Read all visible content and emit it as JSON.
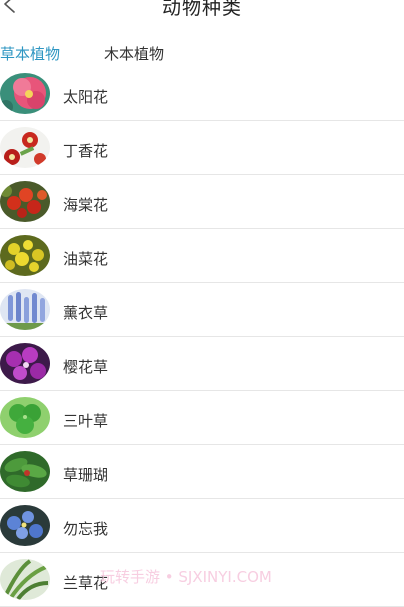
{
  "header": {
    "title": "动物种类",
    "back_icon": "chevron-left-icon"
  },
  "tabs": [
    {
      "label": "草本植物",
      "active": true
    },
    {
      "label": "木本植物",
      "active": false
    }
  ],
  "colors": {
    "accent": "#2e96c2",
    "divider": "#e6e6e6",
    "watermark": "#f7c9de"
  },
  "plants": [
    {
      "name": "太阳花",
      "icon": "pink-flower-photo"
    },
    {
      "name": "丁香花",
      "icon": "red-white-flower-photo"
    },
    {
      "name": "海棠花",
      "icon": "red-fruit-photo"
    },
    {
      "name": "油菜花",
      "icon": "yellow-flower-photo"
    },
    {
      "name": "薰衣草",
      "icon": "lavender-photo"
    },
    {
      "name": "樱花草",
      "icon": "purple-flower-photo"
    },
    {
      "name": "三叶草",
      "icon": "clover-photo"
    },
    {
      "name": "草珊瑚",
      "icon": "green-leaves-photo"
    },
    {
      "name": "勿忘我",
      "icon": "blue-flower-photo"
    },
    {
      "name": "兰草花",
      "icon": "orchid-leaves-photo"
    }
  ],
  "watermark": "玩转手游 • SJXINYI.COM"
}
